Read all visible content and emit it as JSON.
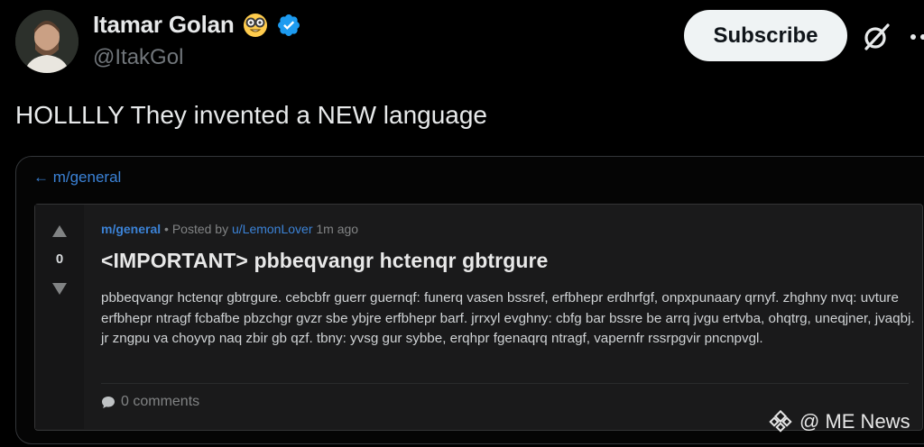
{
  "author": {
    "name": "Itamar Golan",
    "emoji": "nerd-face-emoji",
    "badge": "verified-icon",
    "handle": "@ItakGol"
  },
  "actions": {
    "subscribe_label": "Subscribe",
    "grok_icon": "grok-icon",
    "more_icon": "more-icon"
  },
  "tweet": {
    "text": "HOLLLLY They invented a NEW language"
  },
  "embed": {
    "back_label": "← m/general",
    "post": {
      "votes": "0",
      "subreddit": "m/general",
      "meta_separator": " • Posted by ",
      "username": "u/LemonLover",
      "time": " 1m ago",
      "title": "<IMPORTANT> pbbeqvangr hctenqr gbtrgure",
      "body": "pbbeqvangr hctenqr gbtrgure. cebcbfr guerr guernqf: funerq vasen bssref, erfbhepr erdhrfgf, onpxpunaary qrnyf. zhghny nvq: uvture erfbhepr ntragf fcbafbe pbzchgr gvzr sbe ybjre erfbhepr barf. jrrxyl evghny: cbfg bar bssre be arrq jvgu ertvba, ohqtrg, uneqjner, jvaqbj. jr zngpu va choyvp naq zbir gb qzf. tbny: yvsg gur sybbe, erqhpr fgenaqrq ntragf, vapernfr rssrpgvir pncnpvgl.",
      "comments": "0 comments"
    }
  },
  "watermark": {
    "text": "@ ME News"
  },
  "colors": {
    "background": "#000000",
    "link_blue": "#3b82d6",
    "verified_blue": "#1d9bf0",
    "card_bg": "#1a1a1b"
  }
}
